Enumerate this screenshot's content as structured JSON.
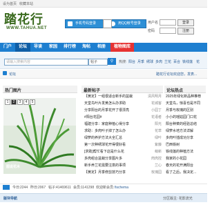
{
  "topbar": {
    "set_home": "设为首页",
    "bookmark": "收藏本站"
  },
  "logo": {
    "text": "踏花行",
    "sub": "WWW.TAHUA.NET"
  },
  "header": {
    "mobile_btn": "手机号码登录",
    "qq_btn": "用QQ帐号登录"
  },
  "login": {
    "user_label": "用户名",
    "pass_label": "密码",
    "login_btn": "登录",
    "register_btn": "注册"
  },
  "nav": [
    {
      "label": "门户"
    },
    {
      "label": "论坛"
    },
    {
      "label": "导读"
    },
    {
      "label": "家园"
    },
    {
      "label": "排行榜"
    },
    {
      "label": "淘帖"
    },
    {
      "label": "相册"
    },
    {
      "label": "植物图库"
    }
  ],
  "search": {
    "placeholder": "请输入搜索内容",
    "type": "帖子",
    "hot_label": "热搜:",
    "hot_tags": [
      "阳台",
      "月季",
      "绣球",
      "多肉",
      "兰花",
      "百合",
      "铁线莲",
      "花"
    ]
  },
  "breadcrumb": {
    "home": "论坛",
    "notice": "踏花行论坛欢迎您，发表..."
  },
  "hot_pics": {
    "title": "热门图片",
    "pages": [
      "1",
      "2",
      "3",
      "4",
      "5"
    ],
    "caption": "图说花木"
  },
  "latest": {
    "title": "最新帖子",
    "rows": [
      {
        "title": "【黄定】一组很适合新手的盆栽",
        "author": "清风明月"
      },
      {
        "title": "天堂鸟叶片发黄怎么办求助",
        "author": "花城客"
      },
      {
        "title": "分享阳台的月季花开了很漂亮",
        "author": "小园丁"
      },
      {
        "title": "#阳台花园#",
        "author": "花语者"
      },
      {
        "title": "福建分享：家庭种植心得分享",
        "author": "阳光"
      },
      {
        "title": "求助：多肉叶子掉了怎么办",
        "author": "花草"
      },
      {
        "title": "绿萝的养护方法大全汇总",
        "author": "绿叶"
      },
      {
        "title": "第一次种绣球花开得很好看",
        "author": "紫藤"
      },
      {
        "title": "[求助]帮忙看下这是什么花",
        "author": "萌新"
      },
      {
        "title": "多肉组合盆栽分享图片多",
        "author": "肉肉控"
      },
      {
        "title": "新手养兰花需要注意的事项",
        "author": "兰心"
      },
      {
        "title": "【黄定】月季修剪技巧分享",
        "author": "玫瑰园"
      }
    ]
  },
  "hot_topics": {
    "title": "论坛热点",
    "rows": [
      "2025年绿化新品种推荐",
      "天堂鸟，惊喜也是不同",
      "月季与玫瑰的区别",
      "小小的瑶姑园门口花",
      "阳台种菜的经验总结",
      "绿萝水培方法详解",
      "多肉叶插成功分享",
      "巴西铁树",
      "铁线莲的种植方法",
      "我家的小花园",
      "春天的花开满阳台",
      "看了之后，我决定..."
    ]
  },
  "stats": {
    "today_label": "今日:",
    "today": "2244",
    "yesterday_label": "昨日:",
    "yesterday": "2067",
    "posts_label": "帖子:",
    "posts": "41469611",
    "members_label": "会员:",
    "members": "1141298",
    "newest_label": "欢迎新会员:",
    "newest": "fischema"
  },
  "subbar": {
    "left": "版块导航",
    "right": "分区版主: 花影流光"
  }
}
